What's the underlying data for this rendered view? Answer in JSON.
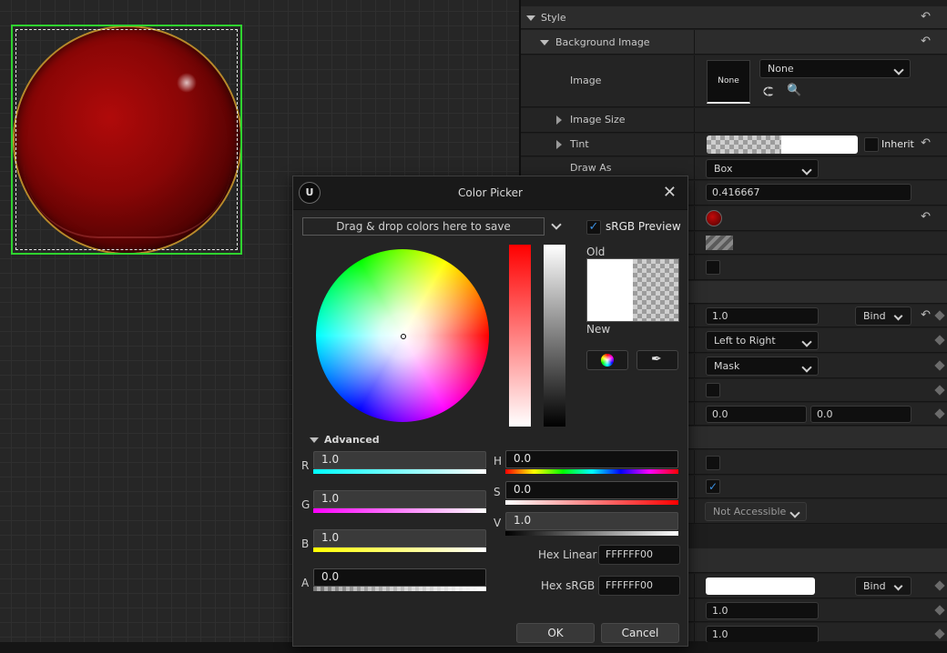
{
  "details": {
    "style_label": "Style",
    "background_image_label": "Background Image",
    "image_label": "Image",
    "image_thumb_text": "None",
    "image_dropdown": "None",
    "image_size_label": "Image Size",
    "tint_label": "Tint",
    "inherit_label": "Inherit",
    "draw_as_label": "Draw As",
    "draw_as_value": "Box",
    "margin_value": "0.416667",
    "opacity_value": "1.0",
    "bind_label": "Bind",
    "direction_value": "Left to Right",
    "fill_type_value": "Mask",
    "scale_x": "0.0",
    "scale_y": "0.0",
    "accessible_value": "Not Accessible",
    "bind_label_2": "Bind",
    "value_1": "1.0",
    "value_2": "1.0"
  },
  "picker": {
    "title": "Color Picker",
    "dropzone": "Drag & drop colors here to save",
    "srgb_preview": "sRGB Preview",
    "old_label": "Old",
    "new_label": "New",
    "advanced_label": "Advanced",
    "r_label": "R",
    "r_value": "1.0",
    "g_label": "G",
    "g_value": "1.0",
    "b_label": "B",
    "b_value": "1.0",
    "a_label": "A",
    "a_value": "0.0",
    "h_label": "H",
    "h_value": "0.0",
    "s_label": "S",
    "s_value": "0.0",
    "v_label": "V",
    "v_value": "1.0",
    "hex_linear_label": "Hex Linear",
    "hex_linear_value": "FFFFFF00",
    "hex_srgb_label": "Hex sRGB",
    "hex_srgb_value": "FFFFFF00",
    "ok_label": "OK",
    "cancel_label": "Cancel"
  },
  "colors": {
    "selection_outline": "#2fd32f",
    "checkbox_check": "#3a8edf",
    "orb_red": "#8a0606",
    "orb_rim": "#b88a2a"
  }
}
